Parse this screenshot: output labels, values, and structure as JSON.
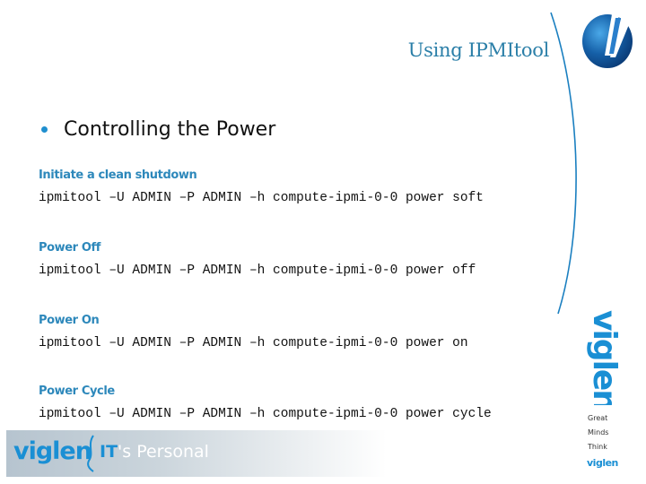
{
  "header": {
    "title": "Using IPMItool",
    "logo_icon": "viglen-v-sphere-icon"
  },
  "main": {
    "bullet": "Controlling the Power",
    "sections": [
      {
        "label": "Initiate a clean shutdown",
        "command": "ipmitool –U ADMIN –P ADMIN –h compute-ipmi-0-0 power soft"
      },
      {
        "label": "Power Off",
        "command": "ipmitool –U ADMIN –P ADMIN –h compute-ipmi-0-0 power off"
      },
      {
        "label": "Power On",
        "command": "ipmitool –U ADMIN –P ADMIN –h compute-ipmi-0-0 power on"
      },
      {
        "label": "Power Cycle",
        "command": "ipmitool –U ADMIN –P ADMIN –h compute-ipmi-0-0 power cycle"
      }
    ]
  },
  "sidebar": {
    "brand_vertical": "viglen",
    "tagline": [
      "Great",
      "Minds",
      "Think"
    ],
    "brand_small": "viglen"
  },
  "footer": {
    "brand": "viglen",
    "slogan_it": "IT",
    "slogan_rest": "'s Personal"
  },
  "colors": {
    "accent": "#2d88bb",
    "brand_blue": "#1a8fd4",
    "text": "#111111"
  }
}
